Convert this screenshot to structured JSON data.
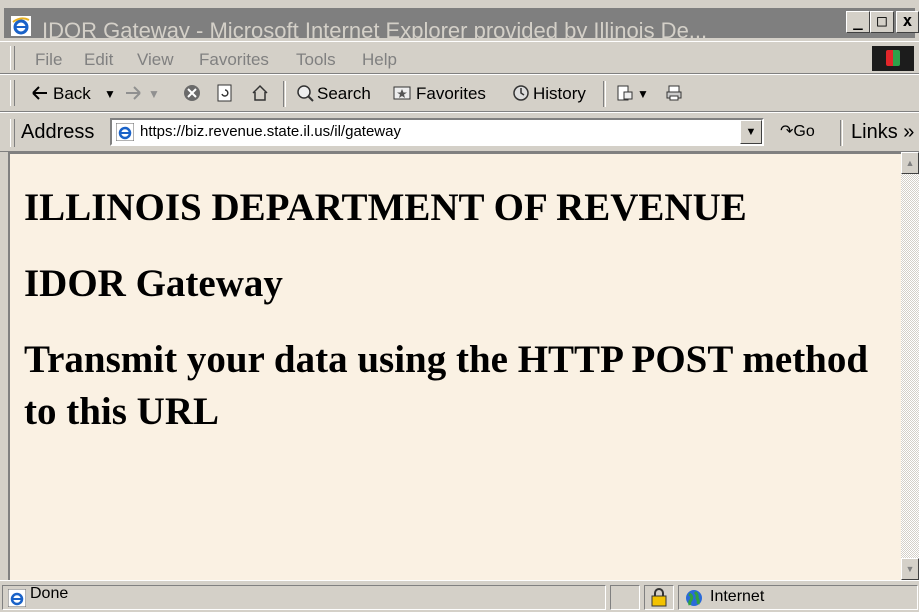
{
  "window": {
    "title": "IDOR Gateway - Microsoft Internet Explorer provided by Illinois De...",
    "buttons": {
      "minimize": "_",
      "maximize": "□",
      "close": "x"
    }
  },
  "menu": [
    "File",
    "Edit",
    "View",
    "Favorites",
    "Tools",
    "Help"
  ],
  "toolbar": {
    "back": "Back",
    "search": "Search",
    "favorites": "Favorites",
    "history": "History"
  },
  "address": {
    "label": "Address",
    "url": "https://biz.revenue.state.il.us/il/gateway",
    "go": "Go",
    "links": "Links »"
  },
  "page": {
    "heading_org": "ILLINOIS DEPARTMENT OF REVENUE",
    "heading_gateway": "IDOR Gateway",
    "heading_instruction": "Transmit your data using the HTTP POST method to this URL"
  },
  "status": {
    "text": "Done",
    "zone": "Internet"
  },
  "colors": {
    "content_bg": "#faf1e3",
    "chrome": "#d4d0c8",
    "title_inactive": "#7f7f7f"
  },
  "icons": [
    "ie-icon",
    "back-arrow-icon",
    "forward-arrow-icon",
    "stop-icon",
    "refresh-icon",
    "home-icon",
    "search-icon",
    "favorites-icon",
    "history-icon",
    "mail-icon",
    "print-icon",
    "lock-icon",
    "globe-icon"
  ]
}
